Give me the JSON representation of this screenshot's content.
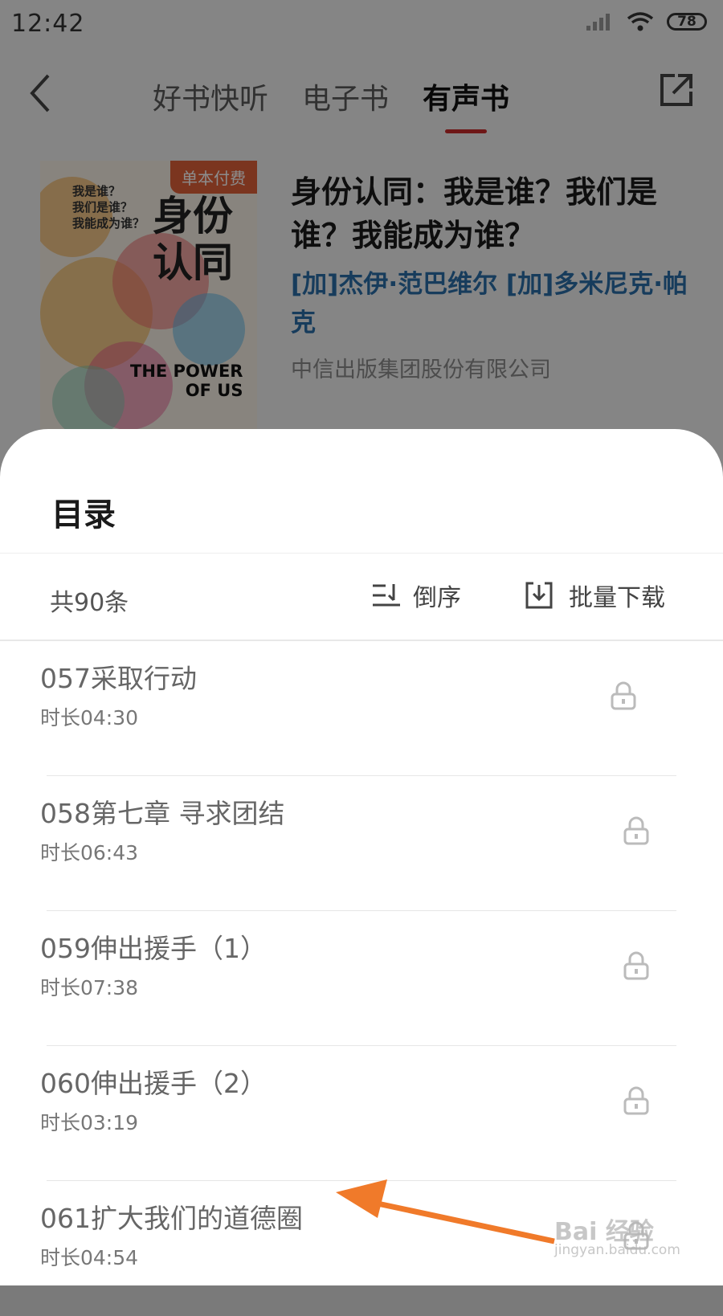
{
  "status": {
    "time": "12:42",
    "battery": "78"
  },
  "nav": {
    "tabs": [
      "好书快听",
      "电子书",
      "有声书"
    ],
    "active_tab": "有声书"
  },
  "book": {
    "cover_badge": "单本付费",
    "cover_title_line1": "身份",
    "cover_title_line2": "认同",
    "cover_questions": [
      "我是谁？",
      "我们是谁？",
      "我能成为谁？"
    ],
    "cover_en_line1": "THE POWER",
    "cover_en_line2": "OF US",
    "title": "身份认同：我是谁？我们是谁？我能成为谁？",
    "authors": "[加]杰伊·范巴维尔 [加]多米尼克·帕克",
    "publisher": "中信出版集团股份有限公司"
  },
  "catalog": {
    "title": "目录",
    "count": "共90条",
    "sort_label": "倒序",
    "download_label": "批量下载",
    "items": [
      {
        "title": "057采取行动",
        "duration": "时长04:30"
      },
      {
        "title": "058第七章 寻求团结",
        "duration": "时长06:43"
      },
      {
        "title": "059伸出援手（1）",
        "duration": "时长07:38"
      },
      {
        "title": "060伸出援手（2）",
        "duration": "时长03:19"
      },
      {
        "title": "061扩大我们的道德圈",
        "duration": "时长04:54"
      }
    ]
  },
  "watermark": {
    "brand": "Bai 经验",
    "url": "jingyan.baidu.com"
  },
  "colors": {
    "accent": "#c92a2a",
    "annotation_arrow": "#f07a2a",
    "author_link": "#2a6ea8"
  }
}
